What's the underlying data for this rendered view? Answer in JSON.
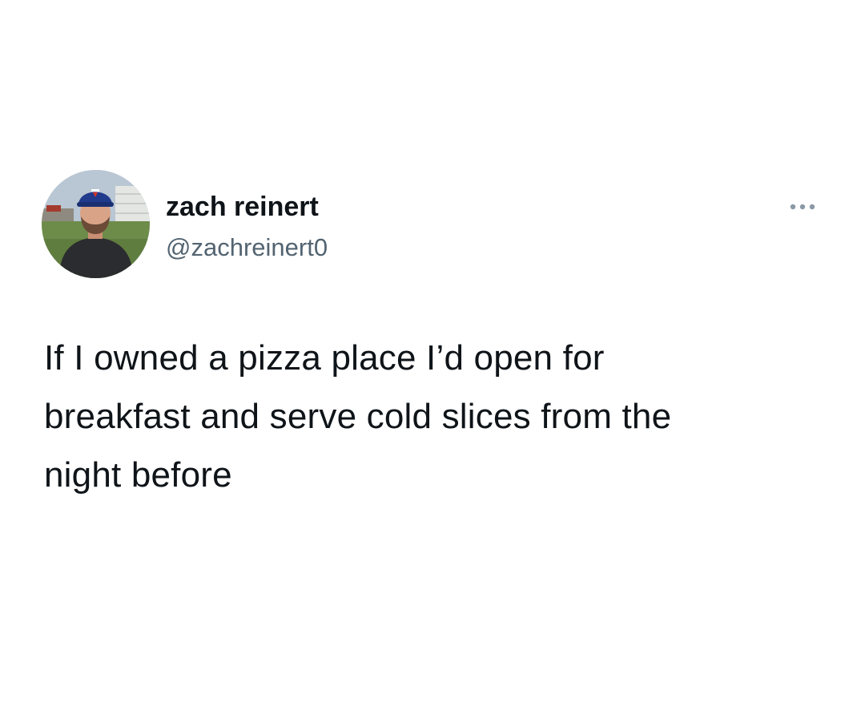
{
  "tweet": {
    "author": {
      "display_name": "zach reinert",
      "handle": "@zachreinert0",
      "avatar_icon": "profile-photo-icon"
    },
    "more_icon": "more-options-icon",
    "text": "If I owned a pizza place I’d open for\nbreakfast and serve cold slices from the\nnight before"
  },
  "colors": {
    "background": "#ffffff",
    "text_primary": "#0f1419",
    "text_secondary": "#536471"
  }
}
